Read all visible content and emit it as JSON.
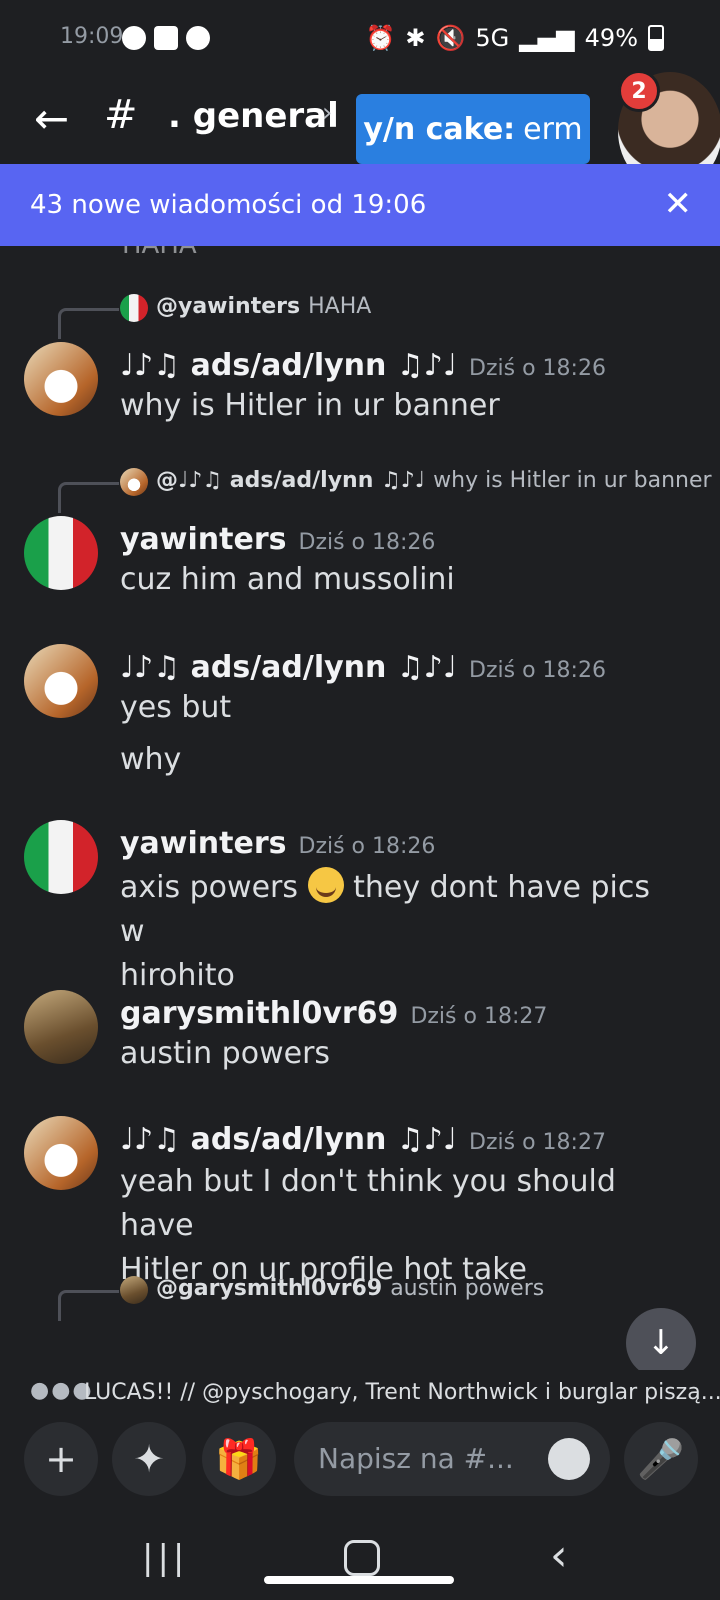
{
  "status": {
    "time": "19:09",
    "battery": "49%",
    "network": "5G"
  },
  "header": {
    "back_icon": "arrow-left-icon",
    "channel_prefix": "#",
    "channel_name": ". general",
    "chevron": "›"
  },
  "bubble": {
    "sender": "y/n cake:",
    "text": "erm",
    "badge": "2"
  },
  "new_messages": {
    "text": "43 nowe wiadomości od 19:06",
    "close": "✕"
  },
  "feed": {
    "clipped_text": "HAHA",
    "messages": [
      {
        "reply_name": "@yawinters",
        "reply_text": "HAHA",
        "author": "♩♪♫ ads/ad/lynn ♫♪♩",
        "time": "Dziś o 18:26",
        "lines": [
          "why is Hitler in ur banner"
        ]
      },
      {
        "reply_name": "@♩♪♫ ads/ad/lynn ♫♪♩",
        "reply_text": "why is Hitler in ur banner",
        "author": "yawinters",
        "time": "Dziś o 18:26",
        "lines": [
          "cuz him and mussolini"
        ]
      },
      {
        "author": "♩♪♫ ads/ad/lynn ♫♪♩",
        "time": "Dziś o 18:26",
        "lines": [
          "yes but",
          "why"
        ]
      },
      {
        "author": "yawinters",
        "time": "Dziś o 18:26",
        "lines": [
          "axis powers",
          "they dont have pics w",
          "hirohito"
        ]
      },
      {
        "author": "garysmithl0vr69",
        "time": "Dziś o 18:27",
        "lines": [
          "austin powers"
        ]
      },
      {
        "author": "♩♪♫ ads/ad/lynn ♫♪♩",
        "time": "Dziś o 18:27",
        "lines": [
          "yeah but I don't think you should have",
          "Hitler on ur profile hot take"
        ]
      },
      {
        "reply_name": "@garysmithl0vr69",
        "reply_text": "austin powers"
      }
    ]
  },
  "typing": {
    "text": "LUCAS!! // @pyschogary, Trent Northwick i burglar piszą..."
  },
  "composer": {
    "placeholder": "Napisz na #...",
    "add_icon": "plus-icon",
    "apps_icon": "apps-icon",
    "gift_icon": "gift-icon",
    "emoji_icon": "emoji-icon",
    "mic_icon": "microphone-icon"
  },
  "colors": {
    "background": "#1e1f22",
    "new_bar": "#5865f2",
    "toast": "#2a7fe0",
    "badge": "#e23d3a"
  }
}
